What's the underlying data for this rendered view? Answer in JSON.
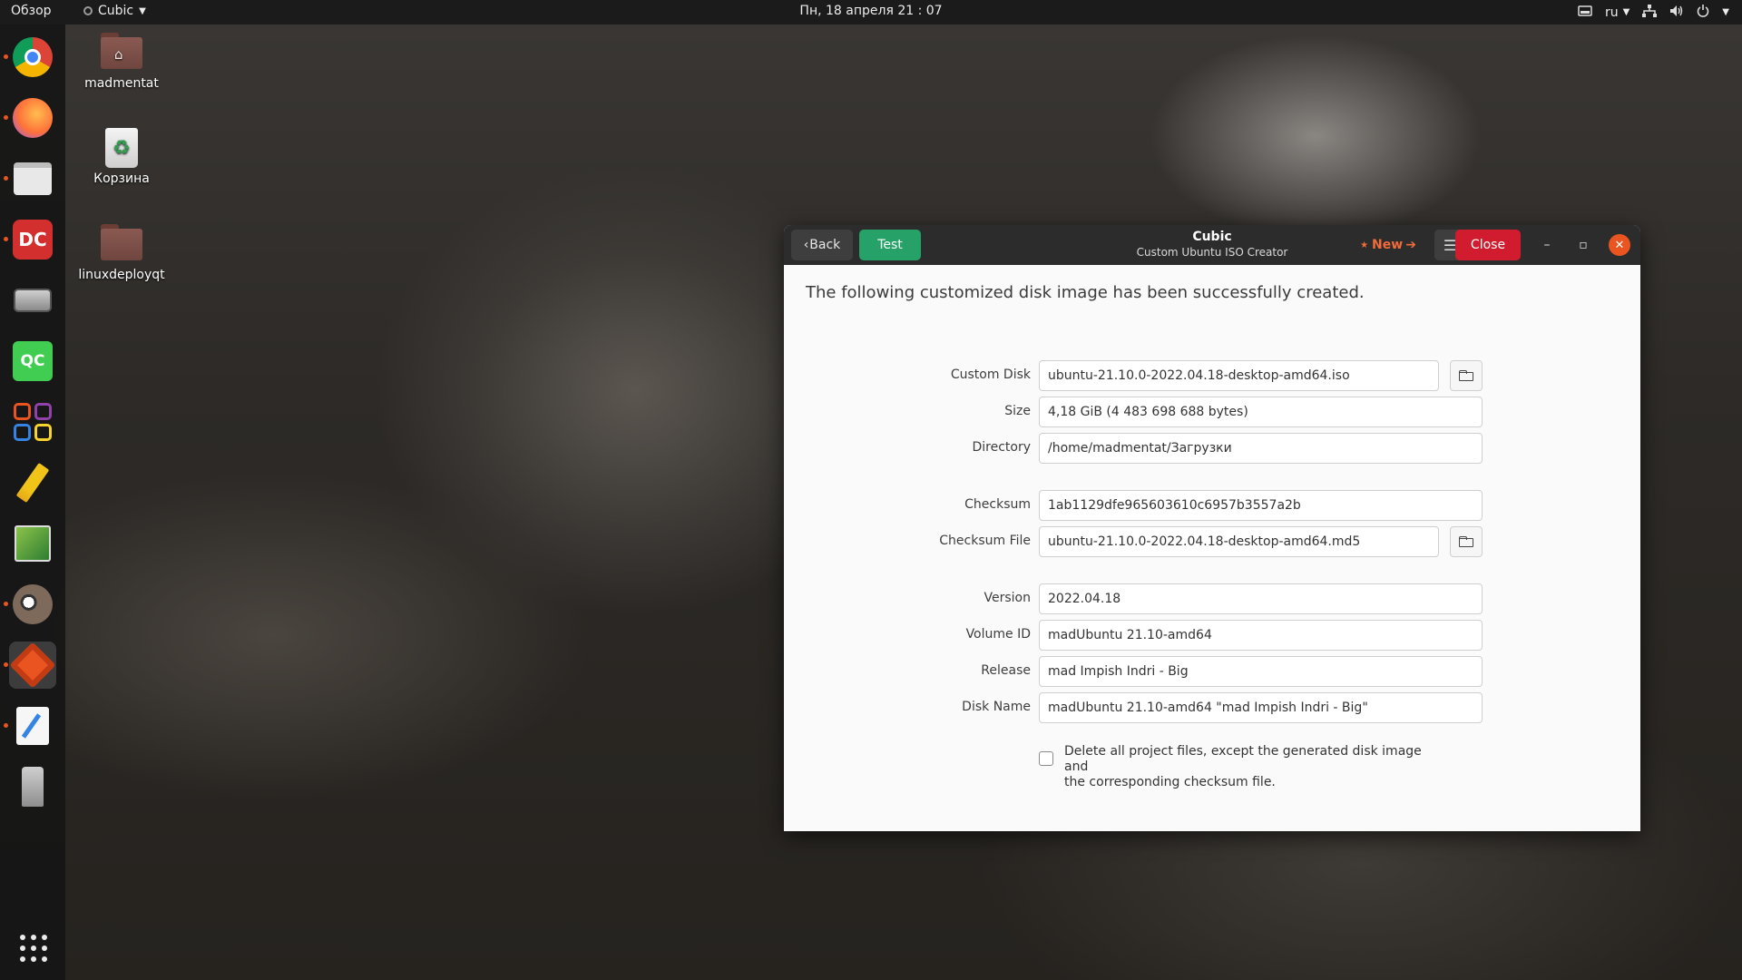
{
  "topbar": {
    "activities": "Обзор",
    "app_name": "Cubic",
    "clock": "Пн, 18 апреля  21 : 07",
    "lang": "ru",
    "tray_icons": [
      "display-icon",
      "network-icon",
      "volume-icon",
      "power-icon"
    ]
  },
  "desktop": {
    "icons": [
      {
        "label": "madmentat",
        "icon": "home-folder-icon"
      },
      {
        "label": "Корзина",
        "icon": "trash-icon"
      },
      {
        "label": "linuxdeployqt",
        "icon": "folder-icon"
      }
    ]
  },
  "dock": {
    "apps": [
      {
        "name": "chrome",
        "icon": "chrome-icon",
        "color": "#4285f4"
      },
      {
        "name": "firefox",
        "icon": "firefox-icon",
        "color": "#ff7139"
      },
      {
        "name": "files",
        "icon": "files-icon",
        "color": "#e6e6e6"
      },
      {
        "name": "double-commander",
        "icon": "double-commander-icon",
        "color": "#d32f2f"
      },
      {
        "name": "disk",
        "icon": "disk-icon",
        "color": "#7a7a7a"
      },
      {
        "name": "qt-creator",
        "icon": "qt-creator-icon",
        "color": "#41cd52",
        "label": "QC"
      },
      {
        "name": "calculator",
        "icon": "calculator-icon",
        "color": "#e95420"
      },
      {
        "name": "editor",
        "icon": "pencil-icon",
        "color": "#f0c419"
      },
      {
        "name": "image-editor",
        "icon": "image-editor-icon",
        "color": "#4caf50"
      },
      {
        "name": "gimp",
        "icon": "gimp-icon",
        "color": "#7d6a5a"
      },
      {
        "name": "cubic",
        "icon": "cubic-icon",
        "color": "#e95420"
      },
      {
        "name": "text-editor",
        "icon": "text-editor-icon",
        "color": "#3584e4"
      },
      {
        "name": "usb",
        "icon": "usb-icon",
        "color": "#9a9a9a"
      }
    ]
  },
  "window": {
    "back_label": "Back",
    "test_label": "Test",
    "title": "Cubic",
    "subtitle": "Custom Ubuntu ISO Creator",
    "new_label": "New",
    "close_label": "Close",
    "headline": "The following customized disk image has been successfully created.",
    "fields": {
      "custom_disk": {
        "label": "Custom Disk",
        "value": "ubuntu-21.10.0-2022.04.18-desktop-amd64.iso"
      },
      "size": {
        "label": "Size",
        "value": "4,18 GiB (4 483 698 688 bytes)"
      },
      "directory": {
        "label": "Directory",
        "value": "/home/madmentat/Загрузки"
      },
      "checksum": {
        "label": "Checksum",
        "value": "1ab1129dfe965603610c6957b3557a2b"
      },
      "checksum_file": {
        "label": "Checksum File",
        "value": "ubuntu-21.10.0-2022.04.18-desktop-amd64.md5"
      },
      "version": {
        "label": "Version",
        "value": "2022.04.18"
      },
      "volume_id": {
        "label": "Volume ID",
        "value": "madUbuntu 21.10-amd64"
      },
      "release": {
        "label": "Release",
        "value": "mad Impish Indri  - Big"
      },
      "disk_name": {
        "label": "Disk Name",
        "value": "madUbuntu 21.10-amd64 \"mad Impish Indri  - Big\""
      }
    },
    "delete_checkbox": {
      "checked": false,
      "line1": "Delete all project files, except the generated disk image and",
      "line2": "the corresponding checksum file."
    }
  },
  "colors": {
    "accent_orange": "#e95420",
    "test_green": "#26a269",
    "close_red": "#d01c2e",
    "headerbar": "#2c2c2c"
  }
}
